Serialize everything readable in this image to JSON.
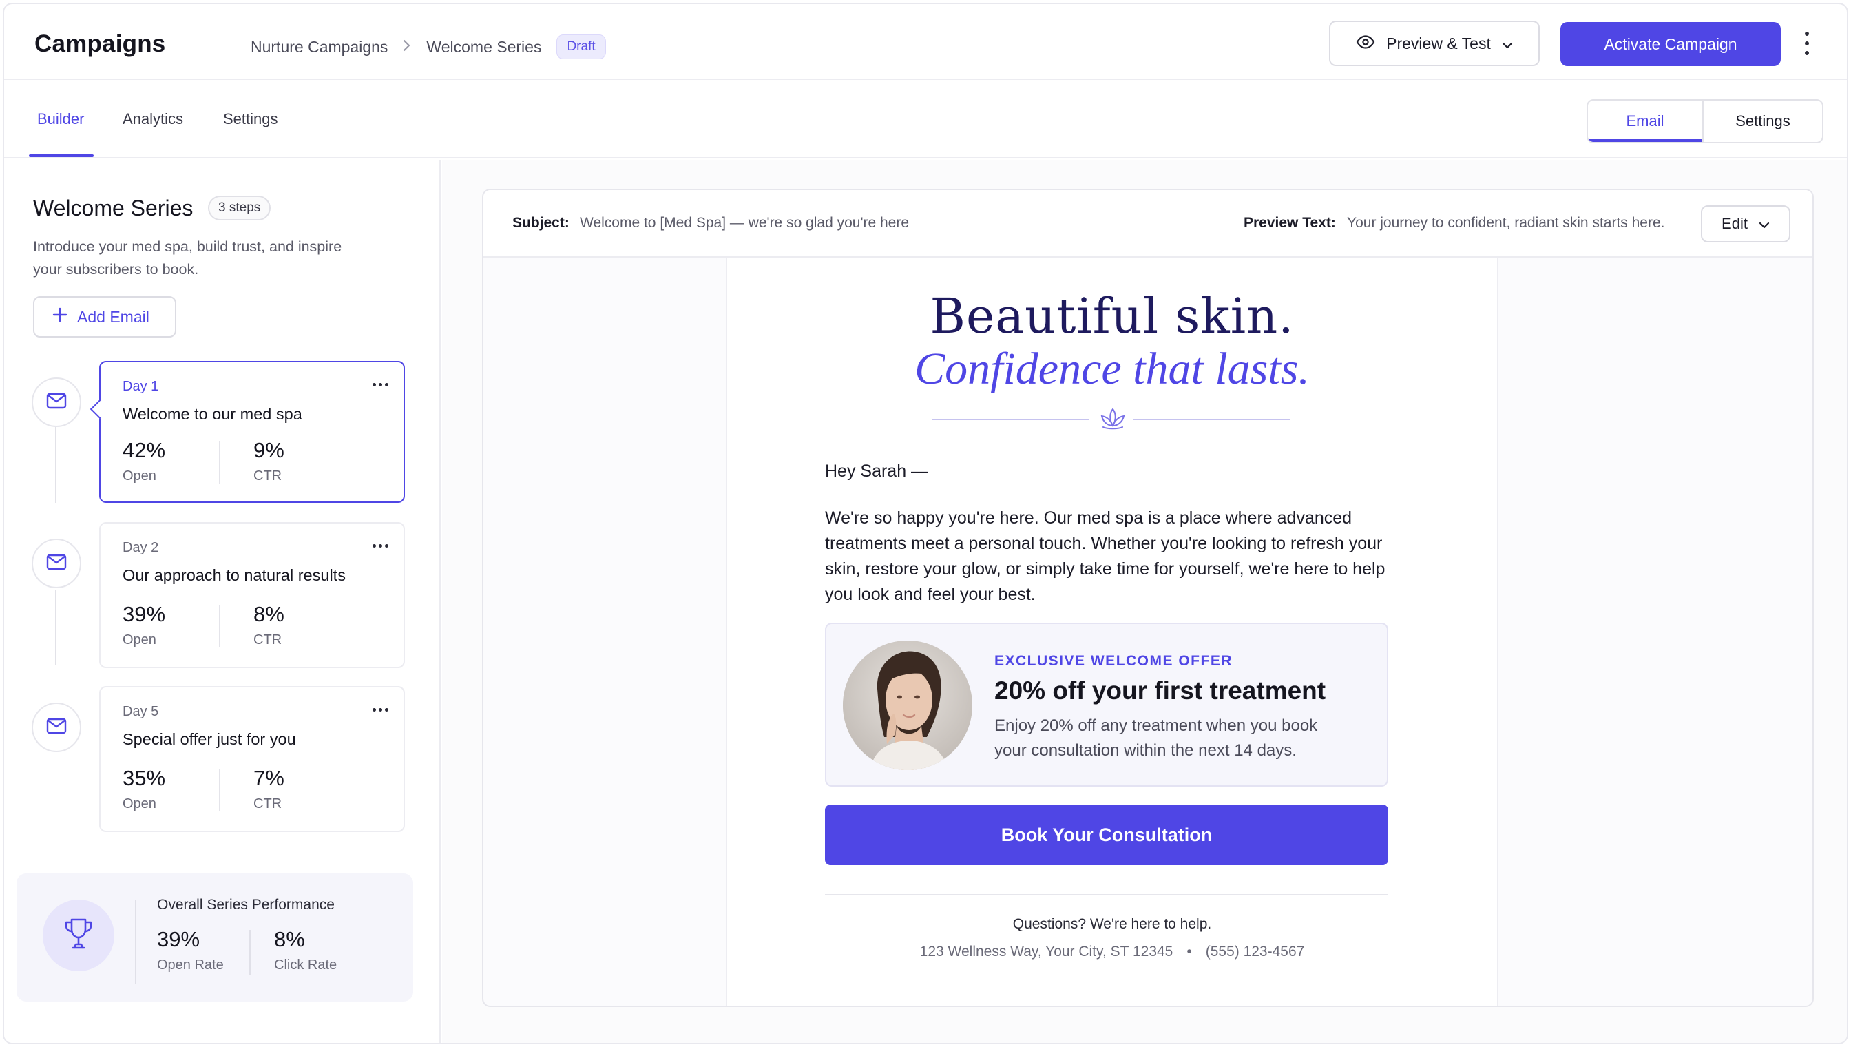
{
  "header": {
    "app_title": "Campaigns",
    "breadcrumb": [
      "Nurture Campaigns",
      "Welcome Series"
    ],
    "status_badge": "Draft",
    "preview_button": "Preview & Test",
    "activate_button": "Activate Campaign"
  },
  "tabs": [
    "Builder",
    "Analytics",
    "Settings"
  ],
  "active_tab": "Builder",
  "view_toggle": {
    "email": "Email",
    "settings": "Settings",
    "selected": "Email"
  },
  "series": {
    "title": "Welcome Series",
    "steps_badge": "3 steps",
    "description": "Introduce your med spa, build trust, and inspire your subscribers to book.",
    "add_button": "Add Email",
    "emails": [
      {
        "day": "Day 1",
        "title": "Welcome to our med spa",
        "open": "42%",
        "open_label": "Open",
        "ctr": "9%",
        "ctr_label": "CTR",
        "selected": true
      },
      {
        "day": "Day 2",
        "title": "Our approach to natural results",
        "open": "39%",
        "open_label": "Open",
        "ctr": "8%",
        "ctr_label": "CTR",
        "selected": false
      },
      {
        "day": "Day 5",
        "title": "Special offer just for you",
        "open": "35%",
        "open_label": "Open",
        "ctr": "7%",
        "ctr_label": "CTR",
        "selected": false
      }
    ],
    "performance": {
      "title": "Overall Series Performance",
      "open_rate": "39%",
      "open_rate_label": "Open Rate",
      "click_rate": "8%",
      "click_rate_label": "Click Rate"
    }
  },
  "email_preview": {
    "subject_label": "Subject:",
    "subject": "Welcome to [Med Spa] — we're so glad you're here",
    "preview_label": "Preview Text:",
    "preview_text": "Your journey to confident, radiant skin starts here.",
    "edit_button": "Edit",
    "headline": "Beautiful skin.",
    "subheadline": "Confidence that lasts.",
    "greeting": "Hey Sarah —",
    "body": "We're so happy you're here. Our med spa is a place where advanced treatments meet a personal touch. Whether you're looking to refresh your skin, restore your glow, or simply take time for yourself, we're here to help you look and feel your best.",
    "offer": {
      "kicker": "EXCLUSIVE WELCOME OFFER",
      "title": "20% off your first treatment",
      "description": "Enjoy 20% off any treatment when you book your consultation within the next 14 days."
    },
    "cta": "Book Your Consultation",
    "footer_question": "Questions? We're here to help.",
    "footer_address": "123 Wellness Way, Your City, ST 12345",
    "footer_separator": "•",
    "footer_phone": "(555) 123-4567"
  },
  "colors": {
    "accent": "#4f46e5",
    "headline": "#1e1a5e",
    "badge_bg": "#ecebfd"
  },
  "icons": [
    "eye-icon",
    "chevron-down-icon",
    "kebab-icon",
    "plus-icon",
    "mail-icon",
    "trophy-icon",
    "lotus-icon"
  ]
}
